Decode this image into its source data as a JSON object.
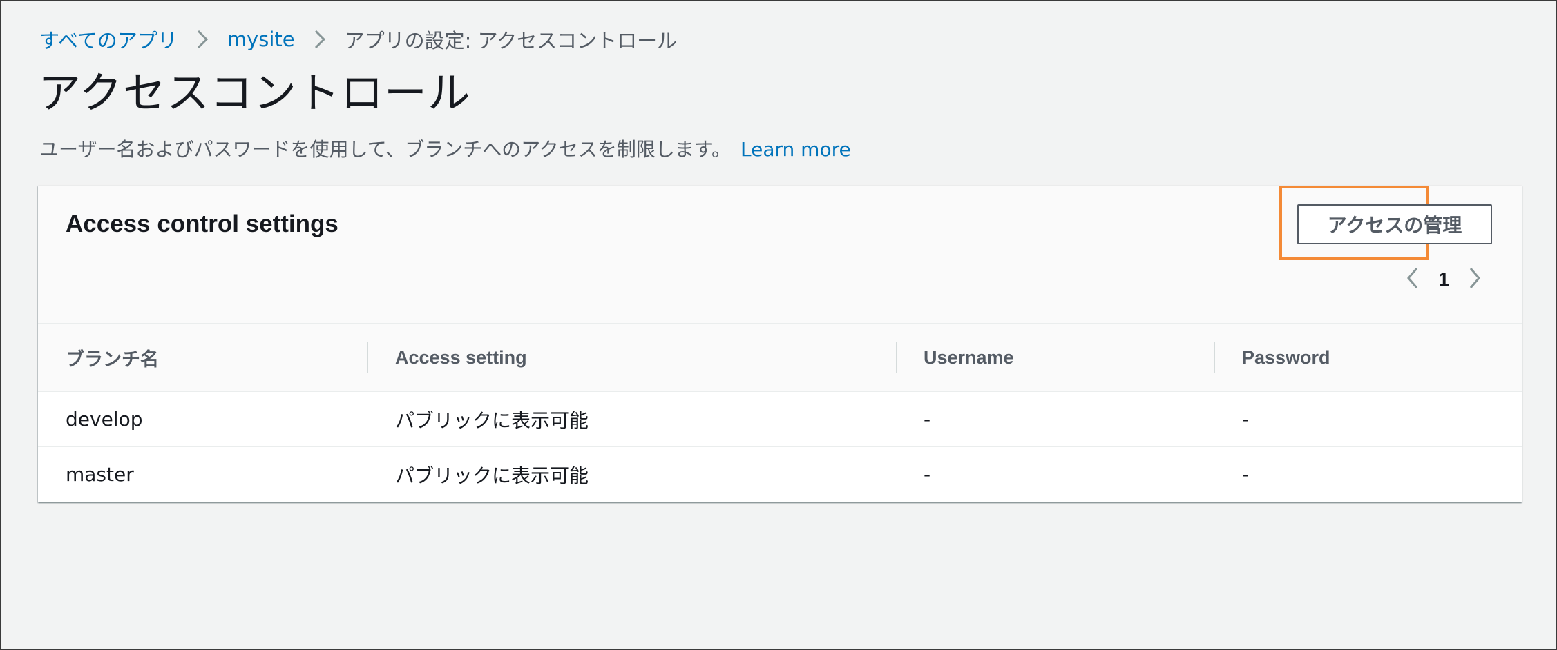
{
  "breadcrumb": {
    "items": [
      {
        "label": "すべてのアプリ"
      },
      {
        "label": "mysite"
      }
    ],
    "current": "アプリの設定: アクセスコントロール"
  },
  "page": {
    "title": "アクセスコントロール",
    "description": "ユーザー名およびパスワードを使用して、ブランチへのアクセスを制限します。",
    "learn_more": "Learn more"
  },
  "panel": {
    "title": "Access control settings",
    "manage_button": "アクセスの管理",
    "pagination": {
      "current_page": "1"
    },
    "table": {
      "columns": [
        "ブランチ名",
        "Access setting",
        "Username",
        "Password"
      ],
      "rows": [
        {
          "branch": "develop",
          "access": "パブリックに表示可能",
          "username": "-",
          "password": "-"
        },
        {
          "branch": "master",
          "access": "パブリックに表示可能",
          "username": "-",
          "password": "-"
        }
      ]
    }
  },
  "colors": {
    "link": "#0073bb",
    "highlight": "#f48a36",
    "background": "#f2f3f3",
    "text": "#16191f",
    "muted_text": "#545b64"
  }
}
